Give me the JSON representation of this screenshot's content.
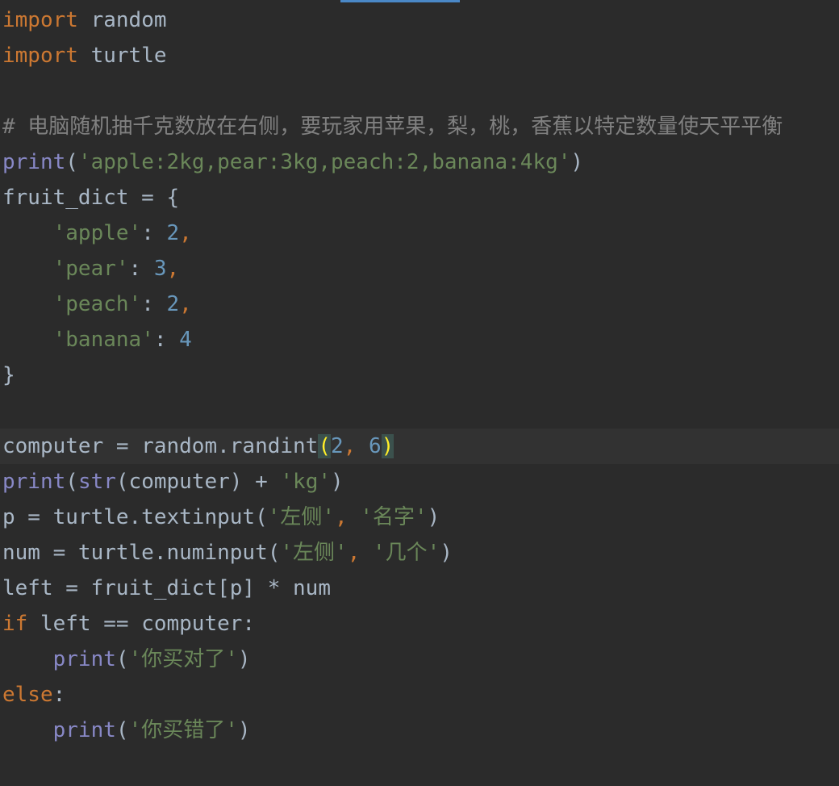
{
  "editor": {
    "language": "python",
    "colors": {
      "background": "#2b2b2b",
      "current_line": "#323232",
      "default_text": "#a9b7c6",
      "keyword": "#cc7832",
      "builtin": "#8888c6",
      "string": "#6a8759",
      "number": "#6897bb",
      "comment": "#808080",
      "matched_brace": "#ffef28",
      "tab_indicator": "#4a88c7"
    },
    "lines": [
      [
        {
          "t": "kw",
          "v": "import"
        },
        {
          "t": "plain",
          "v": " random"
        }
      ],
      [
        {
          "t": "kw",
          "v": "import"
        },
        {
          "t": "plain",
          "v": " turtle"
        }
      ],
      [],
      [
        {
          "t": "cm",
          "v": "# 电脑随机抽千克数放在右侧，要玩家用苹果，梨，桃，香蕉以特定数量使天平平衡"
        }
      ],
      [
        {
          "t": "bi",
          "v": "print"
        },
        {
          "t": "plain",
          "v": "("
        },
        {
          "t": "str",
          "v": "'apple:2kg,pear:3kg,peach:2,banana:4kg'"
        },
        {
          "t": "plain",
          "v": ")"
        }
      ],
      [
        {
          "t": "plain",
          "v": "fruit_dict = {"
        }
      ],
      [
        {
          "t": "plain",
          "v": "    "
        },
        {
          "t": "str",
          "v": "'apple'"
        },
        {
          "t": "plain",
          "v": ": "
        },
        {
          "t": "num",
          "v": "2"
        },
        {
          "t": "kw",
          "v": ","
        }
      ],
      [
        {
          "t": "plain",
          "v": "    "
        },
        {
          "t": "str",
          "v": "'pear'"
        },
        {
          "t": "plain",
          "v": ": "
        },
        {
          "t": "num",
          "v": "3"
        },
        {
          "t": "kw",
          "v": ","
        }
      ],
      [
        {
          "t": "plain",
          "v": "    "
        },
        {
          "t": "str",
          "v": "'peach'"
        },
        {
          "t": "plain",
          "v": ": "
        },
        {
          "t": "num",
          "v": "2"
        },
        {
          "t": "kw",
          "v": ","
        }
      ],
      [
        {
          "t": "plain",
          "v": "    "
        },
        {
          "t": "str",
          "v": "'banana'"
        },
        {
          "t": "plain",
          "v": ": "
        },
        {
          "t": "num",
          "v": "4"
        }
      ],
      [
        {
          "t": "plain",
          "v": "}"
        }
      ],
      [],
      [
        {
          "t": "plain",
          "v": "computer = random.randint"
        },
        {
          "t": "bm",
          "v": "("
        },
        {
          "t": "num",
          "v": "2"
        },
        {
          "t": "kw",
          "v": ", "
        },
        {
          "t": "num",
          "v": "6"
        },
        {
          "t": "bm",
          "v": ")"
        }
      ],
      [
        {
          "t": "bi",
          "v": "print"
        },
        {
          "t": "plain",
          "v": "("
        },
        {
          "t": "bi",
          "v": "str"
        },
        {
          "t": "plain",
          "v": "(computer) + "
        },
        {
          "t": "str",
          "v": "'kg'"
        },
        {
          "t": "plain",
          "v": ")"
        }
      ],
      [
        {
          "t": "plain",
          "v": "p = turtle.textinput("
        },
        {
          "t": "str",
          "v": "'左侧'"
        },
        {
          "t": "kw",
          "v": ", "
        },
        {
          "t": "str",
          "v": "'名字'"
        },
        {
          "t": "plain",
          "v": ")"
        }
      ],
      [
        {
          "t": "plain",
          "v": "num = turtle.numinput("
        },
        {
          "t": "str",
          "v": "'左侧'"
        },
        {
          "t": "kw",
          "v": ", "
        },
        {
          "t": "str",
          "v": "'几个'"
        },
        {
          "t": "plain",
          "v": ")"
        }
      ],
      [
        {
          "t": "plain",
          "v": "left = fruit_dict[p] * num"
        }
      ],
      [
        {
          "t": "kw",
          "v": "if"
        },
        {
          "t": "plain",
          "v": " left == computer:"
        }
      ],
      [
        {
          "t": "plain",
          "v": "    "
        },
        {
          "t": "bi",
          "v": "print"
        },
        {
          "t": "plain",
          "v": "("
        },
        {
          "t": "str",
          "v": "'你买对了'"
        },
        {
          "t": "plain",
          "v": ")"
        }
      ],
      [
        {
          "t": "kw",
          "v": "else"
        },
        {
          "t": "plain",
          "v": ":"
        }
      ],
      [
        {
          "t": "plain",
          "v": "    "
        },
        {
          "t": "bi",
          "v": "print"
        },
        {
          "t": "plain",
          "v": "("
        },
        {
          "t": "str",
          "v": "'你买错了'"
        },
        {
          "t": "plain",
          "v": ")"
        }
      ]
    ],
    "current_line_index": 12
  }
}
